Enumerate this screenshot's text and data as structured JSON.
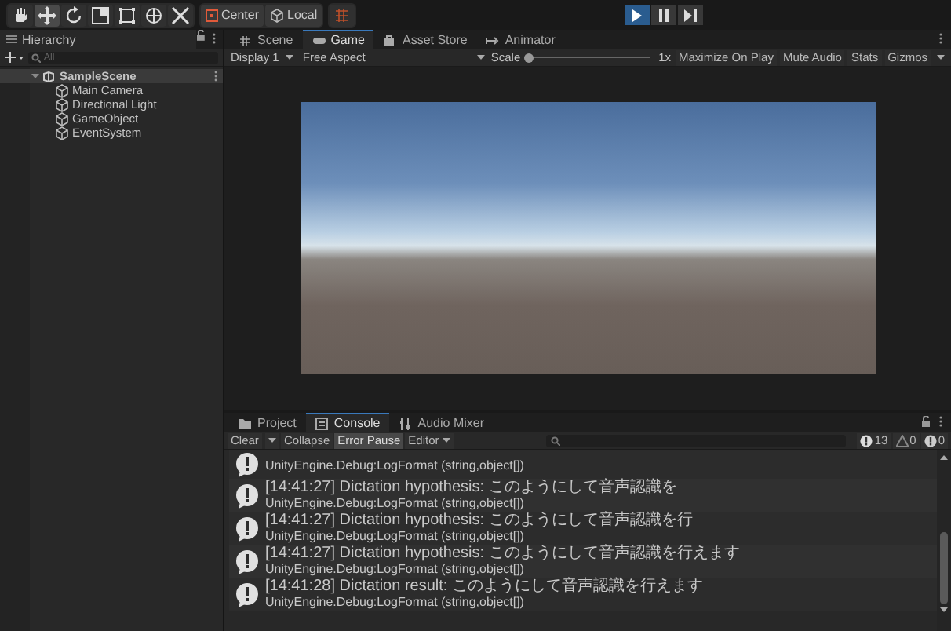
{
  "toolbar": {
    "tools": [
      {
        "kind": "hand",
        "selected": false
      },
      {
        "kind": "move",
        "selected": true
      },
      {
        "kind": "rotate",
        "selected": false
      },
      {
        "kind": "scale",
        "selected": false
      },
      {
        "kind": "rect",
        "selected": false
      },
      {
        "kind": "transform",
        "selected": false
      },
      {
        "kind": "custom",
        "selected": false
      }
    ],
    "pivot_buttons": [
      {
        "kind": "center",
        "label": "Center"
      },
      {
        "kind": "local",
        "label": "Local"
      }
    ],
    "play_controls": [
      {
        "kind": "play",
        "selected": true
      },
      {
        "kind": "pause",
        "selected": false
      },
      {
        "kind": "step",
        "selected": false
      }
    ]
  },
  "hierarchy": {
    "title": "Hierarchy",
    "search": {
      "placeholder": "All"
    },
    "tree": [
      {
        "label": "SampleScene",
        "selected": true,
        "expanded": true,
        "children": [
          {
            "label": "Main Camera",
            "selected": false
          },
          {
            "label": "Directional Light",
            "selected": false
          },
          {
            "label": "GameObject",
            "selected": false
          },
          {
            "label": "EventSystem",
            "selected": false
          }
        ]
      }
    ]
  },
  "view_tabs": [
    {
      "kind": "scene",
      "label": "Scene",
      "selected": false
    },
    {
      "kind": "game",
      "label": "Game",
      "selected": true
    },
    {
      "kind": "store",
      "label": "Asset Store",
      "selected": false
    },
    {
      "kind": "animator",
      "label": "Animator",
      "selected": false
    }
  ],
  "game_toolbar": {
    "display": "Display 1",
    "aspect": "Free Aspect",
    "scale_label": "Scale",
    "scale": {
      "level": 0.0
    },
    "scale_reading": "1x",
    "toggles": [
      {
        "label": "Maximize On Play",
        "on": false
      },
      {
        "label": "Mute Audio",
        "on": false
      },
      {
        "label": "Stats",
        "on": false
      },
      {
        "label": "Gizmos",
        "on": false
      }
    ]
  },
  "bottom_tabs": [
    {
      "kind": "project",
      "label": "Project",
      "selected": false
    },
    {
      "kind": "console",
      "label": "Console",
      "selected": true
    },
    {
      "kind": "mixer",
      "label": "Audio Mixer",
      "selected": false
    }
  ],
  "console": {
    "buttons": [
      {
        "label": "Clear",
        "on": false
      },
      {
        "label": "Collapse",
        "on": false
      },
      {
        "label": "Error Pause",
        "on": true
      },
      {
        "label": "Editor",
        "on": false
      }
    ],
    "counts": [
      {
        "kind": "info",
        "count": "13"
      },
      {
        "kind": "warning",
        "count": "0"
      },
      {
        "kind": "error",
        "count": "0"
      }
    ],
    "entries": [
      {
        "trace": "UnityEngine.Debug:LogFormat (string,object[])"
      },
      {
        "message": "[14:41:27] Dictation hypothesis: このようにして音声認識を",
        "trace": "UnityEngine.Debug:LogFormat (string,object[])"
      },
      {
        "message": "[14:41:27] Dictation hypothesis: このようにして音声認識を行",
        "trace": "UnityEngine.Debug:LogFormat (string,object[])"
      },
      {
        "message": "[14:41:27] Dictation hypothesis: このようにして音声認識を行えます",
        "trace": "UnityEngine.Debug:LogFormat (string,object[])"
      },
      {
        "message": "[14:41:28] Dictation result: このようにして音声認識を行えます",
        "trace": "UnityEngine.Debug:LogFormat (string,object[])"
      }
    ]
  }
}
